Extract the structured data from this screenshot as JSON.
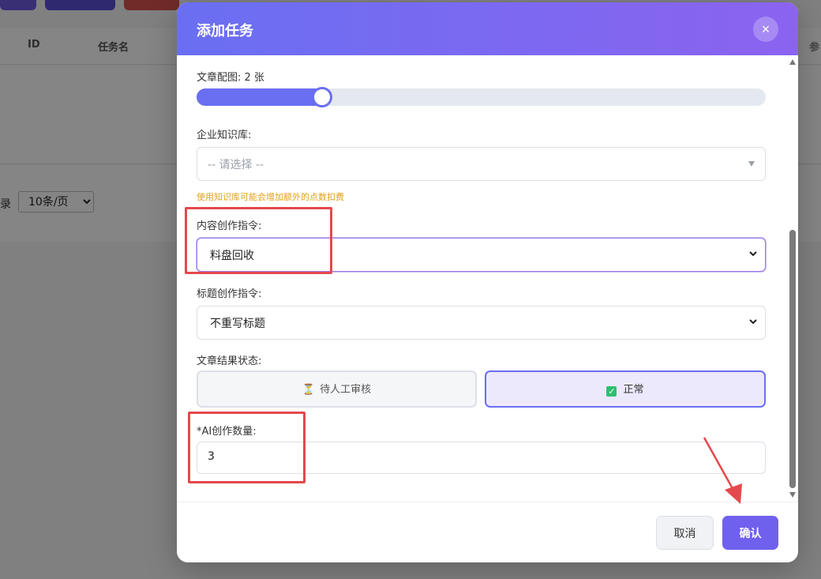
{
  "background": {
    "table_columns": [
      "ID",
      "任务名",
      "参"
    ],
    "pager": {
      "label": "录",
      "page_size": "10条/页"
    }
  },
  "modal": {
    "title": "添加任务",
    "close_symbol": "×",
    "image_count": {
      "label": "文章配图: 2 张",
      "value": 2,
      "fill_fraction": 0.22
    },
    "knowledge_base": {
      "label": "企业知识库:",
      "placeholder": "-- 请选择 --",
      "hint": "使用知识库可能会增加额外的点数扣费"
    },
    "content_instruction": {
      "label": "内容创作指令:",
      "value": "料盘回收"
    },
    "title_instruction": {
      "label": "标题创作指令:",
      "value": "不重写标题"
    },
    "result_status": {
      "label": "文章结果状态:",
      "options": [
        "待人工审核",
        "正常"
      ],
      "selected": "正常"
    },
    "ai_count": {
      "label": "*AI创作数量:",
      "value": "3"
    },
    "footer": {
      "cancel_label": "取消",
      "confirm_label": "确认"
    }
  },
  "colors": {
    "header_start": "#6a6ff2",
    "header_end": "#8b63f0",
    "accent": "#6a6ff2",
    "confirm": "#7060ee",
    "hint": "#e0a21a",
    "annotation": "#e5484d",
    "success": "#2fbf71"
  },
  "annotations": {
    "highlight_boxes": [
      "content-instruction",
      "ai-count"
    ],
    "arrow_target": "confirm-button"
  }
}
